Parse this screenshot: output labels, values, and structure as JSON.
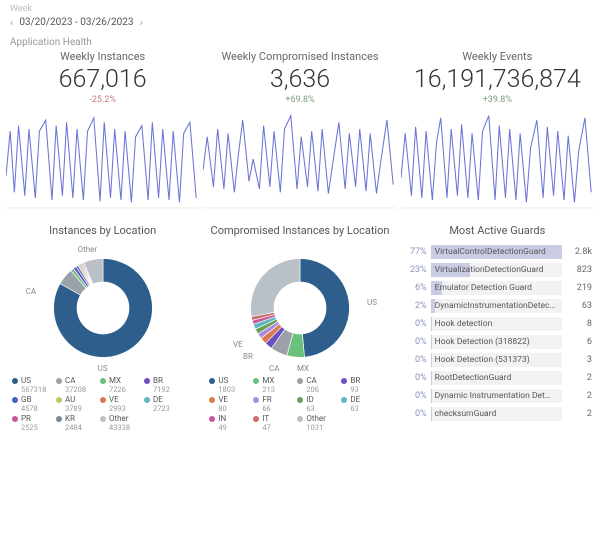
{
  "header": {
    "week_label": "Week",
    "date_range": "03/20/2023 - 03/26/2023"
  },
  "section_title": "Application Health",
  "kpis": [
    {
      "title": "Weekly Instances",
      "value": "667,016",
      "delta": "-25.2%",
      "dir": "neg"
    },
    {
      "title": "Weekly Compromised Instances",
      "value": "3,636",
      "delta": "+69.8%",
      "dir": "pos"
    },
    {
      "title": "Weekly Events",
      "value": "16,191,736,874",
      "delta": "+39.8%",
      "dir": "pos"
    }
  ],
  "colors": {
    "spark_stroke": "#5561c4",
    "spark_grid": "#eee"
  },
  "chart_data": {
    "sparklines": {
      "type": "line",
      "note": "approximate weekly oscillation traces, three panels",
      "paths": [
        "M0,60 L4,20 L8,75 L12,15 L18,78 L22,18 L28,80 L32,20 L38,10 L44,82 L48,15 L54,78 L58,12 L64,80 L68,18 L74,82 L78,20 L84,8 L90,83 L94,12 L100,80 L104,18 L110,82 L114,20 L120,84 L124,25 L130,15 L136,82 L140,12 L146,80 L150,18 L156,82 L160,20 L166,84 L170,22 L176,12 L182,80",
        "M0,55 L4,25 L10,70 L14,18 L20,72 L24,22 L30,75 L34,40 L38,10 L44,65 L48,45 L54,72 L58,15 L64,70 L68,20 L74,75 L78,18 L84,6 L90,72 L94,25 L100,70 L104,20 L110,74 L114,18 L120,76 L124,50 L130,12 L136,72 L140,22 L146,70 L150,18 L156,74 L160,22 L166,76 L170,48 L176,10 L182,68",
        "M0,62 L4,22 L10,78 L14,16 L20,80 L24,20 L30,82 L34,30 L38,8 L44,80 L48,18 L54,78 L58,14 L64,80 L68,22 L74,82 L78,20 L84,6 L90,82 L94,15 L100,80 L104,18 L110,82 L114,22 L120,84 L124,35 L130,10 L136,80 L140,16 L146,78 L150,20 L156,82 L160,24 L166,84 L170,38 L176,8 L182,75"
      ]
    },
    "instances_by_location": {
      "type": "pie",
      "title": "Instances by Location",
      "series": [
        {
          "code": "US",
          "value": 567318,
          "color": "#2e5e8c"
        },
        {
          "code": "CA",
          "value": 37208,
          "color": "#9aa1a8"
        },
        {
          "code": "MX",
          "value": 7226,
          "color": "#6ac17d"
        },
        {
          "code": "BR",
          "value": 7192,
          "color": "#6d4fbf"
        },
        {
          "code": "GB",
          "value": 4578,
          "color": "#3d5fcf"
        },
        {
          "code": "AU",
          "value": 3789,
          "color": "#c6c36a"
        },
        {
          "code": "VE",
          "value": 2993,
          "color": "#d97a4f"
        },
        {
          "code": "DE",
          "value": 2723,
          "color": "#5fb7c6"
        },
        {
          "code": "PR",
          "value": 2525,
          "color": "#c9539e"
        },
        {
          "code": "KR",
          "value": 2484,
          "color": "#7a8a94"
        },
        {
          "code": "Other",
          "value": 43338,
          "color": "#b9c0c6"
        }
      ],
      "callouts": {
        "top": "Other",
        "left": "CA",
        "bottom": "US"
      }
    },
    "compromised_by_location": {
      "type": "pie",
      "title": "Compromised Instances by Location",
      "series": [
        {
          "code": "US",
          "value": 1803,
          "color": "#2e5e8c"
        },
        {
          "code": "MX",
          "value": 213,
          "color": "#6ac17d"
        },
        {
          "code": "CA",
          "value": 206,
          "color": "#9aa1a8"
        },
        {
          "code": "BR",
          "value": 93,
          "color": "#6d4fbf"
        },
        {
          "code": "VE",
          "value": 80,
          "color": "#d97a4f"
        },
        {
          "code": "FR",
          "value": 66,
          "color": "#a98de0"
        },
        {
          "code": "ID",
          "value": 63,
          "color": "#6b9e55"
        },
        {
          "code": "DE",
          "value": 63,
          "color": "#5fb7c6"
        },
        {
          "code": "IN",
          "value": 49,
          "color": "#c9539e"
        },
        {
          "code": "IT",
          "value": 47,
          "color": "#cc6b6b"
        },
        {
          "code": "Other",
          "value": 1031,
          "color": "#b9c0c6"
        }
      ],
      "callouts": {
        "right": "US",
        "bl1": "VE",
        "bl2": "BR",
        "bottom1": "CA",
        "bottom2": "MX"
      }
    },
    "most_active_guards": {
      "type": "bar",
      "title": "Most Active Guards",
      "rows": [
        {
          "pct": "77%",
          "name": "VirtualControlDetectionGuard",
          "display": "2.8k",
          "fill": 100
        },
        {
          "pct": "23%",
          "name": "VirtualizationDetectionGuard",
          "display": "823",
          "fill": 30
        },
        {
          "pct": "6%",
          "name": "Emulator Detection Guard",
          "display": "219",
          "fill": 9
        },
        {
          "pct": "2%",
          "name": "DynamicInstrumentationDetec…",
          "display": "63",
          "fill": 3
        },
        {
          "pct": "0%",
          "name": "Hook detection",
          "display": "8",
          "fill": 1
        },
        {
          "pct": "0%",
          "name": "Hook Detection (318822)",
          "display": "6",
          "fill": 1
        },
        {
          "pct": "0%",
          "name": "Hook Detection (531373)",
          "display": "3",
          "fill": 1
        },
        {
          "pct": "0%",
          "name": "RootDetectionGuard",
          "display": "2",
          "fill": 1
        },
        {
          "pct": "0%",
          "name": "Dynamic Instrumentation Det…",
          "display": "2",
          "fill": 1
        },
        {
          "pct": "0%",
          "name": "checksumGuard",
          "display": "2",
          "fill": 1
        }
      ]
    }
  }
}
